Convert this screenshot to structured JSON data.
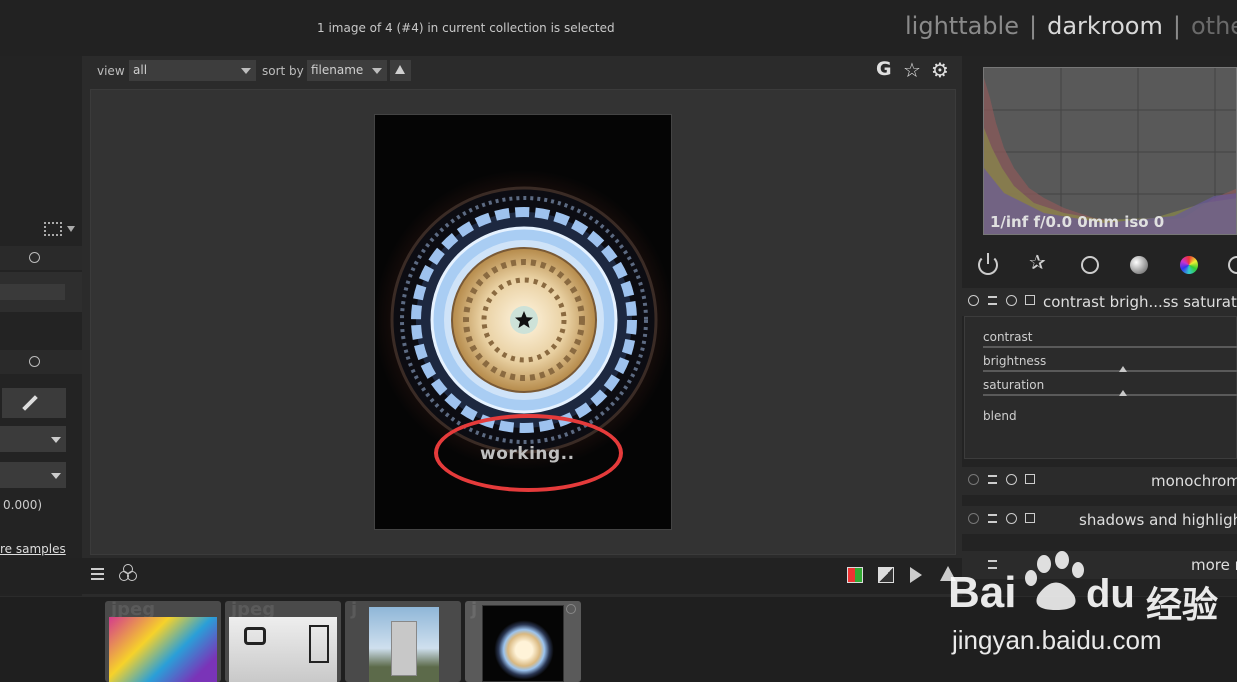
{
  "header": {
    "selection_info": "1 image of 4 (#4) in current collection is selected",
    "views": [
      "lighttable",
      "darkroom",
      "other"
    ],
    "separator": "|"
  },
  "toolbar": {
    "view_label": "view",
    "view_value": "all",
    "sort_label": "sort by",
    "sort_value": "filename",
    "icons": [
      "grouping-G-icon",
      "star-icon",
      "gear-icon"
    ],
    "g_glyph": "G",
    "star_glyph": "☆",
    "gear_glyph": "⚙"
  },
  "center": {
    "status_text": "working..",
    "annotation_color": "#e53b3b"
  },
  "left_panel": {
    "partial_value": "0.000)",
    "link_text": "re samples"
  },
  "right_panel": {
    "exif": "1/inf f/0.0 0mm iso 0",
    "group_icons": [
      "power-icon",
      "star-icon",
      "circle-icon",
      "gradient-circle-icon",
      "color-wheel-icon",
      "refresh-icon"
    ],
    "active_module": {
      "name": "contrast brigh...ss saturation",
      "sliders": [
        {
          "label": "contrast",
          "level": 0.5
        },
        {
          "label": "brightness",
          "level": 0.55
        },
        {
          "label": "saturation",
          "level": 0.55
        }
      ],
      "blend_label": "blend"
    },
    "modules": [
      {
        "name": "monochrome"
      },
      {
        "name": "shadows and highlights"
      }
    ],
    "more_label": "more m"
  },
  "bottombar": {
    "icons": [
      "menu-icon",
      "styles-icon",
      "color-picker-icon",
      "exposure-icon",
      "softproof-icon",
      "warning-icon"
    ]
  },
  "filmstrip": {
    "thumbs": [
      {
        "label": "jpeg"
      },
      {
        "label": "jpeg"
      },
      {
        "label": "j"
      },
      {
        "label": "j"
      }
    ]
  },
  "watermark": {
    "brand": "Bai",
    "brand2": "du",
    "cn": "经验",
    "url": "jingyan.baidu.com"
  }
}
